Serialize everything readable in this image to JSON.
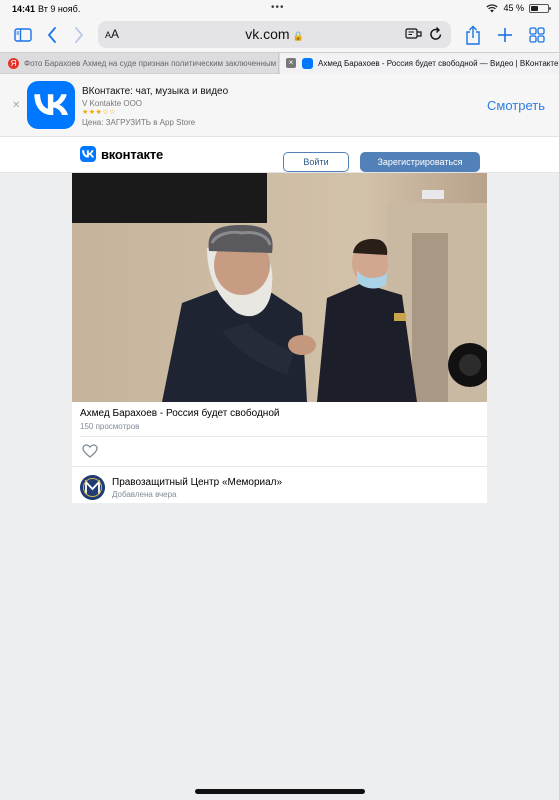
{
  "status": {
    "time": "14:41",
    "date": "Вт 9 нояб.",
    "battery": "45 %",
    "battery_level": 0.45
  },
  "toolbar": {
    "text_size": "AA",
    "url": "vk.com"
  },
  "tabs": [
    {
      "title": "Фото Барахоев Ахмед на суде признан политическим заключенным",
      "active": false
    },
    {
      "title": "Ахмед Барахоев - Россия будет свободной — Видео | ВКонтакте",
      "active": true
    }
  ],
  "app_banner": {
    "title": "ВКонтакте: чат, музыка и видео",
    "developer": "V Kontakte OOO",
    "stars": "★★★☆☆",
    "price": "Цена: ЗАГРУЗИТЬ в App Store",
    "view_label": "Смотреть"
  },
  "vk_header": {
    "logo_text": "вконтакте",
    "login_label": "Войти",
    "register_label": "Зарегистрироваться"
  },
  "video": {
    "title": "Ахмед Барахоев - Россия будет свободной",
    "views": "150 просмотров"
  },
  "author": {
    "name": "Правозащитный Центр «Мемориал»",
    "added": "Добавлена вчера"
  },
  "colors": {
    "vk_blue": "#0077ff",
    "button_blue": "#5181b8",
    "safari_blue": "#1a73e8",
    "page_bg": "#edeef0"
  }
}
